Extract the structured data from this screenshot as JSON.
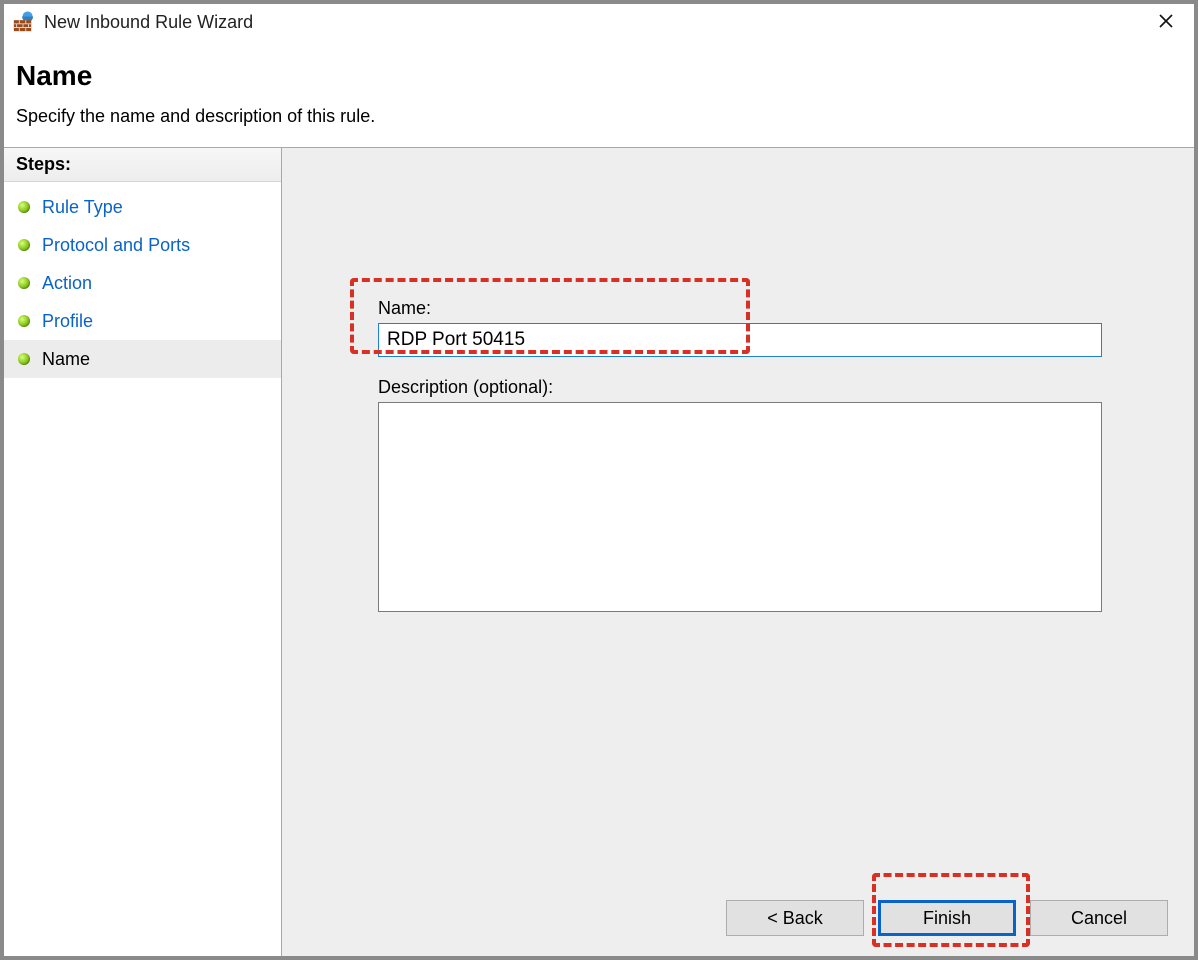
{
  "window": {
    "title": "New Inbound Rule Wizard"
  },
  "header": {
    "title": "Name",
    "subtitle": "Specify the name and description of this rule."
  },
  "sidebar": {
    "steps_label": "Steps:",
    "items": [
      {
        "label": "Rule Type"
      },
      {
        "label": "Protocol and Ports"
      },
      {
        "label": "Action"
      },
      {
        "label": "Profile"
      },
      {
        "label": "Name"
      }
    ],
    "current_index": 4
  },
  "form": {
    "name_label": "Name:",
    "name_value": "RDP Port 50415",
    "description_label": "Description (optional):",
    "description_value": ""
  },
  "buttons": {
    "back": "< Back",
    "finish": "Finish",
    "cancel": "Cancel"
  }
}
